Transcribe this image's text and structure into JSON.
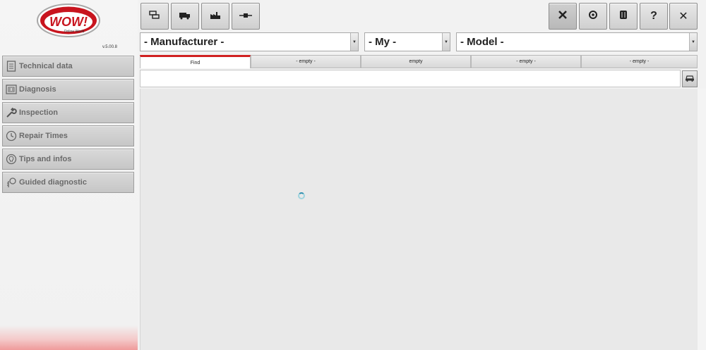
{
  "app": {
    "logo_text": "WOW!",
    "logo_subtitle": "Online World",
    "version": "v.5.00.8"
  },
  "toolbar": {
    "left_buttons": [
      {
        "icon": "vehicles-icon"
      },
      {
        "icon": "truck-icon"
      },
      {
        "icon": "factory-icon"
      },
      {
        "icon": "connector-icon"
      }
    ],
    "right_buttons": [
      {
        "icon": "tools-icon"
      },
      {
        "icon": "settings-icon"
      },
      {
        "icon": "database-icon"
      },
      {
        "icon": "help-icon",
        "label": "?"
      },
      {
        "icon": "close-icon",
        "label": "✕"
      }
    ]
  },
  "selectors": {
    "manufacturer": "- Manufacturer -",
    "my": "- My -",
    "model": "- Model -"
  },
  "tabs": [
    {
      "label": "Find",
      "active": true
    },
    {
      "label": "- empty -"
    },
    {
      "label": "empty"
    },
    {
      "label": "-  empty  -"
    },
    {
      "label": "-  empty  -"
    }
  ],
  "search": {
    "value": "",
    "placeholder": ""
  },
  "sidebar": {
    "items": [
      {
        "label": "Technical data",
        "icon": "document-icon"
      },
      {
        "label": "Diagnosis",
        "icon": "diagnosis-icon"
      },
      {
        "label": "Inspection",
        "icon": "wrench-icon"
      },
      {
        "label": "Repair Times",
        "icon": "clock-icon"
      },
      {
        "label": "Tips and infos",
        "icon": "lightbulb-icon"
      },
      {
        "label": "Guided diagnostic",
        "icon": "key-search-icon"
      }
    ]
  },
  "colors": {
    "accent": "#d02020",
    "logo_red": "#c8141e",
    "spinner": "#2d8fb0"
  }
}
